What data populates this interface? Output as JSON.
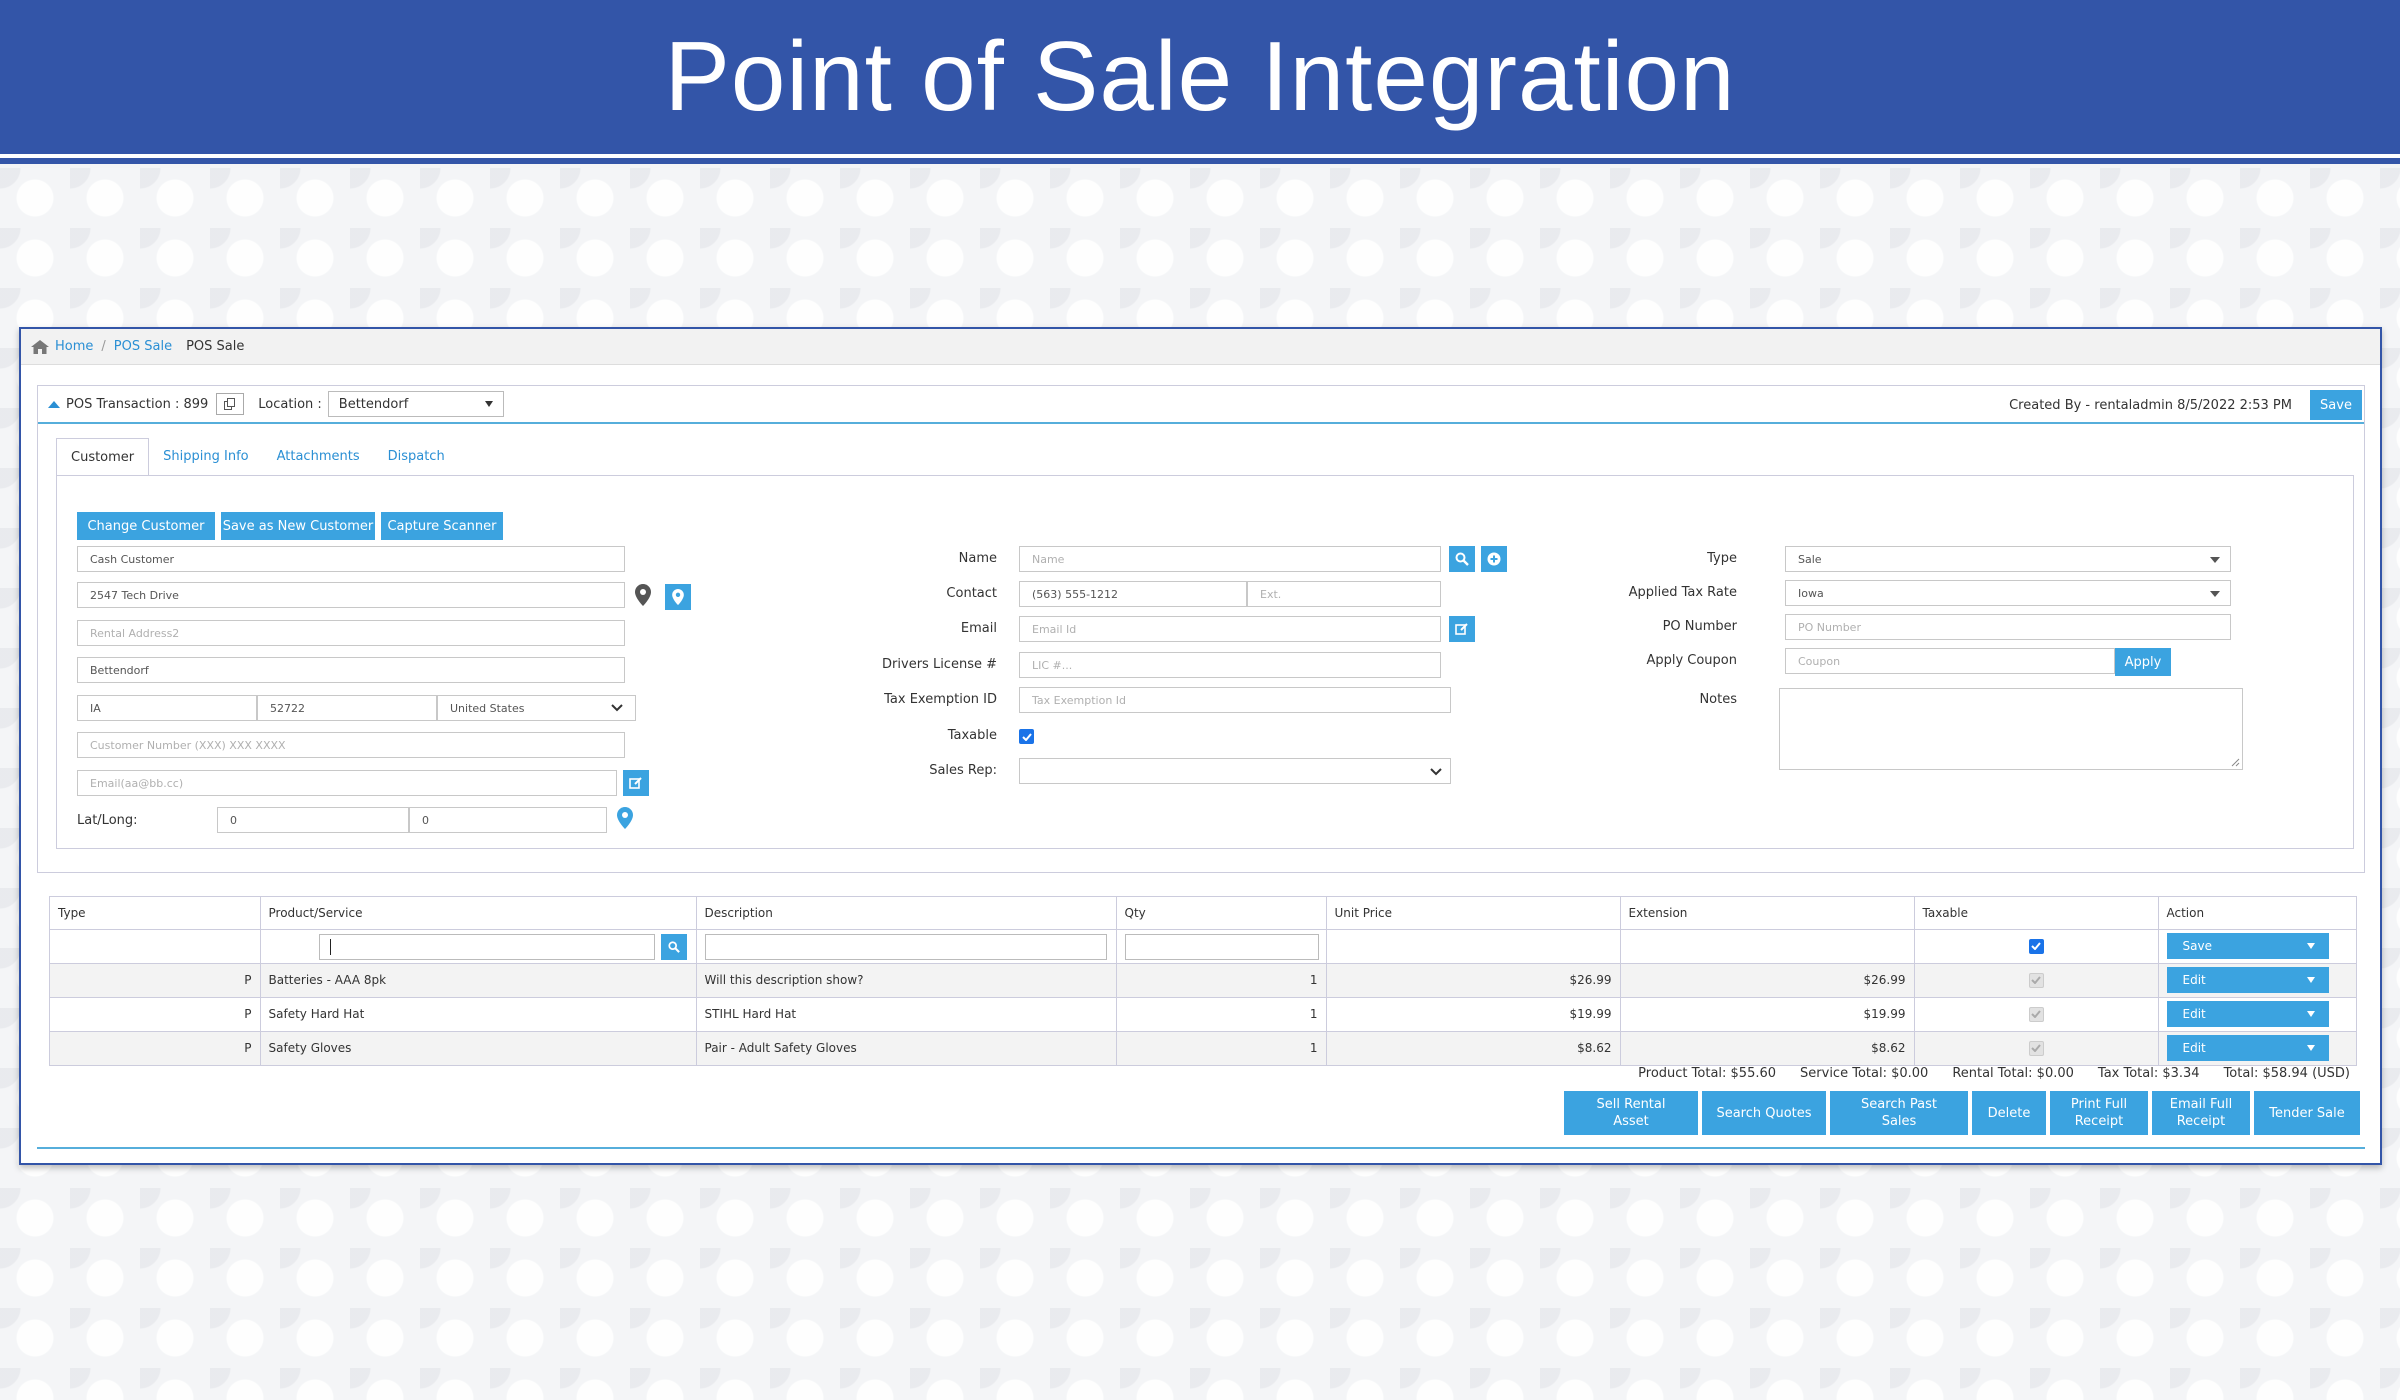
{
  "banner": {
    "title": "Point of Sale Integration"
  },
  "breadcrumb": {
    "home": "Home",
    "sep": "/",
    "pos_sale": "POS Sale",
    "current": "POS Sale"
  },
  "header": {
    "transaction_label": "POS Transaction : 899",
    "location_label": "Location :",
    "location_value": "Bettendorf",
    "created_by": "Created By - rentaladmin 8/5/2022 2:53 PM",
    "save_label": "Save"
  },
  "tabs": [
    {
      "label": "Customer",
      "active": true
    },
    {
      "label": "Shipping Info"
    },
    {
      "label": "Attachments"
    },
    {
      "label": "Dispatch"
    }
  ],
  "customer": {
    "change_customer": "Change Customer",
    "save_new_customer": "Save as New Customer",
    "capture_scanner": "Capture Scanner",
    "name": "Cash Customer",
    "address1": "2547 Tech Drive",
    "address2_placeholder": "Rental Address2",
    "city": "Bettendorf",
    "state": "IA",
    "zip": "52722",
    "country": "United States",
    "customer_number_placeholder": "Customer Number (XXX) XXX XXXX",
    "email_placeholder": "Email(aa@bb.cc)",
    "latlong_label": "Lat/Long:",
    "lat": "0",
    "long": "0"
  },
  "contact": {
    "name_label": "Name",
    "name_placeholder": "Name",
    "contact_label": "Contact",
    "phone": "(563) 555-1212",
    "ext_placeholder": "Ext.",
    "email_label": "Email",
    "email_placeholder": "Email Id",
    "license_label": "Drivers License #",
    "license_placeholder": "LIC #...",
    "taxid_label": "Tax Exemption ID",
    "taxid_placeholder": "Tax Exemption Id",
    "taxable_label": "Taxable",
    "salesrep_label": "Sales Rep:"
  },
  "order": {
    "type_label": "Type",
    "type_value": "Sale",
    "taxrate_label": "Applied Tax Rate",
    "taxrate_value": "Iowa",
    "po_label": "PO Number",
    "po_placeholder": "PO Number",
    "coupon_label": "Apply Coupon",
    "coupon_placeholder": "Coupon",
    "apply_label": "Apply",
    "notes_label": "Notes"
  },
  "grid": {
    "headers": [
      "Type",
      "Product/Service",
      "Description",
      "Qty",
      "Unit Price",
      "Extension",
      "Taxable",
      "Action"
    ],
    "new_row_action": "Save",
    "rows": [
      {
        "type": "P",
        "product": "Batteries - AAA 8pk",
        "description": "Will this description show?",
        "qty": "1",
        "unit_price": "$26.99",
        "extension": "$26.99",
        "action": "Edit"
      },
      {
        "type": "P",
        "product": "Safety Hard Hat",
        "description": "STIHL Hard Hat",
        "qty": "1",
        "unit_price": "$19.99",
        "extension": "$19.99",
        "action": "Edit"
      },
      {
        "type": "P",
        "product": "Safety Gloves",
        "description": "Pair - Adult Safety Gloves",
        "qty": "1",
        "unit_price": "$8.62",
        "extension": "$8.62",
        "action": "Edit"
      }
    ]
  },
  "totals": {
    "product": "Product Total: $55.60",
    "service": "Service Total: $0.00",
    "rental": "Rental Total: $0.00",
    "tax": "Tax Total: $3.34",
    "total": "Total: $58.94 (USD)"
  },
  "actions": {
    "sell_rental_asset": "Sell Rental Asset",
    "search_quotes": "Search Quotes",
    "search_past_sales": "Search Past Sales",
    "delete": "Delete",
    "print_full_receipt": "Print Full Receipt",
    "email_full_receipt": "Email Full Receipt",
    "tender_sale": "Tender Sale"
  },
  "colors": {
    "banner": "#3355a8",
    "accent": "#3ba3e0",
    "link": "#2a8fd4"
  }
}
